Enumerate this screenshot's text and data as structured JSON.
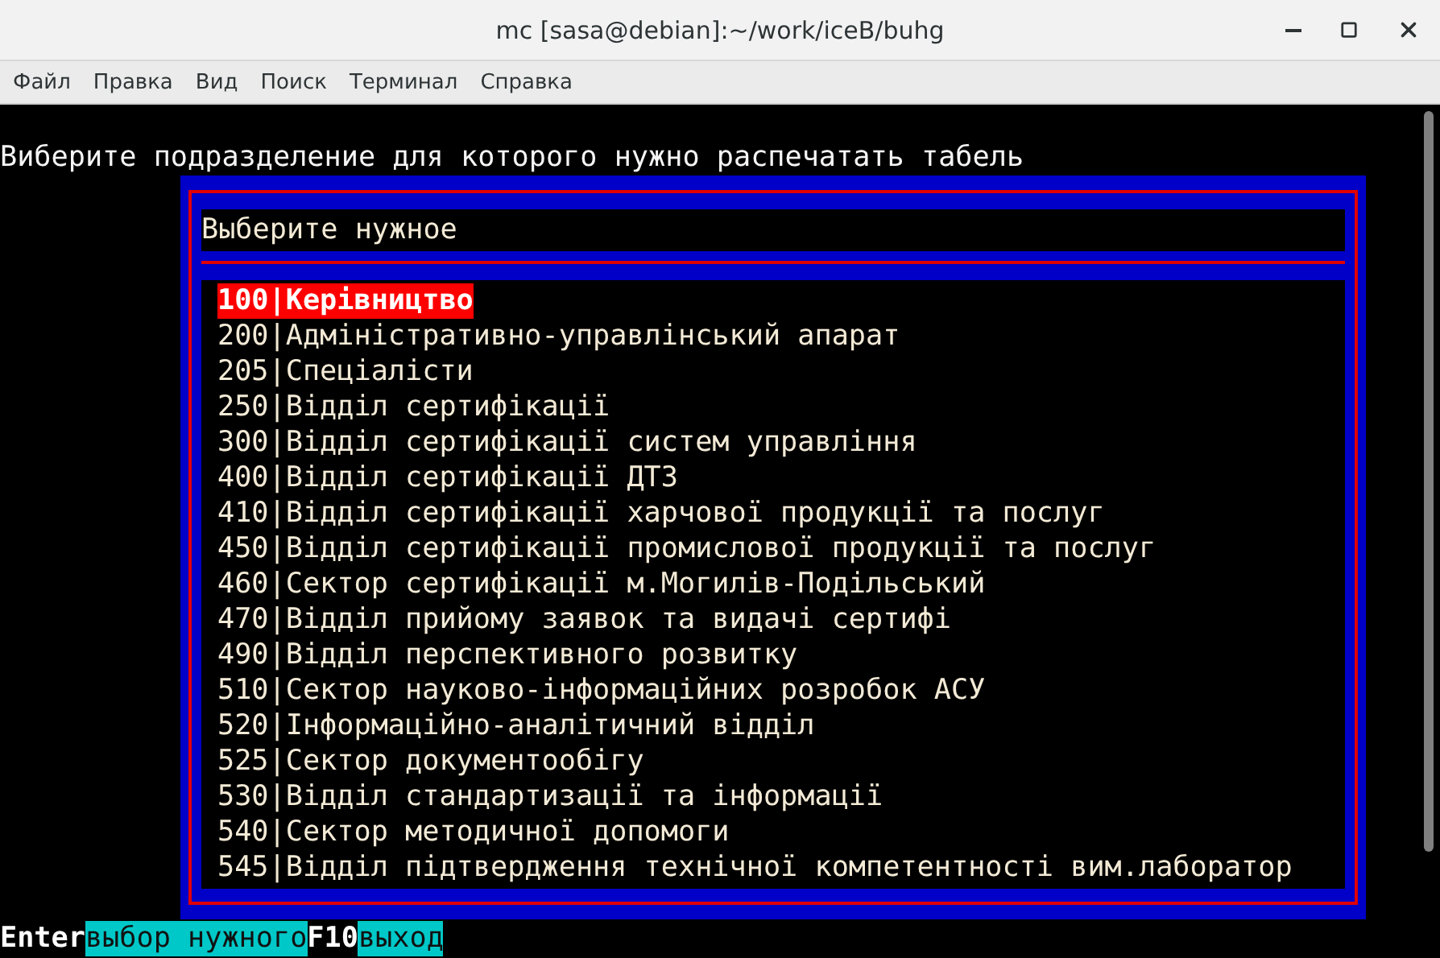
{
  "window": {
    "title": "mc [sasa@debian]:~/work/iceB/buhg"
  },
  "menu": [
    "Файл",
    "Правка",
    "Вид",
    "Поиск",
    "Терминал",
    "Справка"
  ],
  "prompt": "Виберите подразделение для которого нужно распечатать табель",
  "dialog": {
    "title": "Выберите нужное",
    "items": [
      {
        "text": "100|Керівництво",
        "selected": true
      },
      {
        "text": "200|Адміністративно-управлінський апарат",
        "selected": false
      },
      {
        "text": "205|Спеціалісти",
        "selected": false
      },
      {
        "text": "250|Відділ сертифікації",
        "selected": false
      },
      {
        "text": "300|Відділ сертифікації систем управління",
        "selected": false
      },
      {
        "text": "400|Відділ сертифікації ДТЗ",
        "selected": false
      },
      {
        "text": "410|Відділ сертифікації харчової продукції та послуг",
        "selected": false
      },
      {
        "text": "450|Відділ сертифікації промислової продукції та послуг",
        "selected": false
      },
      {
        "text": "460|Сектор сертифікації м.Могилів-Подільський",
        "selected": false
      },
      {
        "text": "470|Відділ прийому заявок та видачі сертифі",
        "selected": false
      },
      {
        "text": "490|Відділ перспективного розвитку",
        "selected": false
      },
      {
        "text": "510|Сектор науково-інформаційних розробок АСУ",
        "selected": false
      },
      {
        "text": "520|Інформаційно-аналітичний відділ",
        "selected": false
      },
      {
        "text": "525|Сектор документообігу",
        "selected": false
      },
      {
        "text": "530|Відділ стандартизації та інформації",
        "selected": false
      },
      {
        "text": "540|Сектор методичної допомоги",
        "selected": false
      },
      {
        "text": "545|Відділ підтвердження технічної компетентності вим.лаборатор",
        "selected": false
      }
    ]
  },
  "hotkeys": [
    {
      "key": "Enter",
      "label": "выбор нужного"
    },
    {
      "key": "F10",
      "label": "выход"
    }
  ]
}
